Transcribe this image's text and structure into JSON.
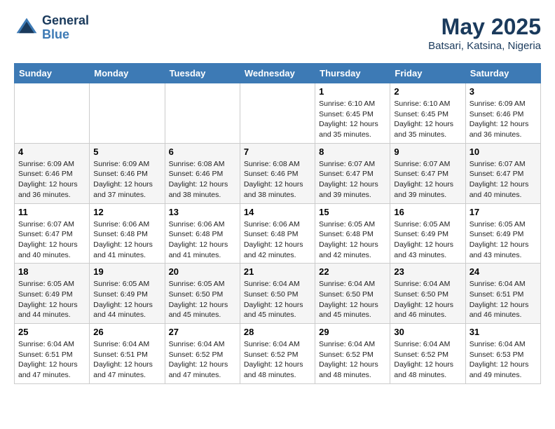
{
  "header": {
    "logo_line1": "General",
    "logo_line2": "Blue",
    "month_year": "May 2025",
    "location": "Batsari, Katsina, Nigeria"
  },
  "weekdays": [
    "Sunday",
    "Monday",
    "Tuesday",
    "Wednesday",
    "Thursday",
    "Friday",
    "Saturday"
  ],
  "weeks": [
    [
      {
        "day": "",
        "sunrise": "",
        "sunset": "",
        "daylight": ""
      },
      {
        "day": "",
        "sunrise": "",
        "sunset": "",
        "daylight": ""
      },
      {
        "day": "",
        "sunrise": "",
        "sunset": "",
        "daylight": ""
      },
      {
        "day": "",
        "sunrise": "",
        "sunset": "",
        "daylight": ""
      },
      {
        "day": "1",
        "sunrise": "Sunrise: 6:10 AM",
        "sunset": "Sunset: 6:45 PM",
        "daylight": "Daylight: 12 hours and 35 minutes."
      },
      {
        "day": "2",
        "sunrise": "Sunrise: 6:10 AM",
        "sunset": "Sunset: 6:45 PM",
        "daylight": "Daylight: 12 hours and 35 minutes."
      },
      {
        "day": "3",
        "sunrise": "Sunrise: 6:09 AM",
        "sunset": "Sunset: 6:46 PM",
        "daylight": "Daylight: 12 hours and 36 minutes."
      }
    ],
    [
      {
        "day": "4",
        "sunrise": "Sunrise: 6:09 AM",
        "sunset": "Sunset: 6:46 PM",
        "daylight": "Daylight: 12 hours and 36 minutes."
      },
      {
        "day": "5",
        "sunrise": "Sunrise: 6:09 AM",
        "sunset": "Sunset: 6:46 PM",
        "daylight": "Daylight: 12 hours and 37 minutes."
      },
      {
        "day": "6",
        "sunrise": "Sunrise: 6:08 AM",
        "sunset": "Sunset: 6:46 PM",
        "daylight": "Daylight: 12 hours and 38 minutes."
      },
      {
        "day": "7",
        "sunrise": "Sunrise: 6:08 AM",
        "sunset": "Sunset: 6:46 PM",
        "daylight": "Daylight: 12 hours and 38 minutes."
      },
      {
        "day": "8",
        "sunrise": "Sunrise: 6:07 AM",
        "sunset": "Sunset: 6:47 PM",
        "daylight": "Daylight: 12 hours and 39 minutes."
      },
      {
        "day": "9",
        "sunrise": "Sunrise: 6:07 AM",
        "sunset": "Sunset: 6:47 PM",
        "daylight": "Daylight: 12 hours and 39 minutes."
      },
      {
        "day": "10",
        "sunrise": "Sunrise: 6:07 AM",
        "sunset": "Sunset: 6:47 PM",
        "daylight": "Daylight: 12 hours and 40 minutes."
      }
    ],
    [
      {
        "day": "11",
        "sunrise": "Sunrise: 6:07 AM",
        "sunset": "Sunset: 6:47 PM",
        "daylight": "Daylight: 12 hours and 40 minutes."
      },
      {
        "day": "12",
        "sunrise": "Sunrise: 6:06 AM",
        "sunset": "Sunset: 6:48 PM",
        "daylight": "Daylight: 12 hours and 41 minutes."
      },
      {
        "day": "13",
        "sunrise": "Sunrise: 6:06 AM",
        "sunset": "Sunset: 6:48 PM",
        "daylight": "Daylight: 12 hours and 41 minutes."
      },
      {
        "day": "14",
        "sunrise": "Sunrise: 6:06 AM",
        "sunset": "Sunset: 6:48 PM",
        "daylight": "Daylight: 12 hours and 42 minutes."
      },
      {
        "day": "15",
        "sunrise": "Sunrise: 6:05 AM",
        "sunset": "Sunset: 6:48 PM",
        "daylight": "Daylight: 12 hours and 42 minutes."
      },
      {
        "day": "16",
        "sunrise": "Sunrise: 6:05 AM",
        "sunset": "Sunset: 6:49 PM",
        "daylight": "Daylight: 12 hours and 43 minutes."
      },
      {
        "day": "17",
        "sunrise": "Sunrise: 6:05 AM",
        "sunset": "Sunset: 6:49 PM",
        "daylight": "Daylight: 12 hours and 43 minutes."
      }
    ],
    [
      {
        "day": "18",
        "sunrise": "Sunrise: 6:05 AM",
        "sunset": "Sunset: 6:49 PM",
        "daylight": "Daylight: 12 hours and 44 minutes."
      },
      {
        "day": "19",
        "sunrise": "Sunrise: 6:05 AM",
        "sunset": "Sunset: 6:49 PM",
        "daylight": "Daylight: 12 hours and 44 minutes."
      },
      {
        "day": "20",
        "sunrise": "Sunrise: 6:05 AM",
        "sunset": "Sunset: 6:50 PM",
        "daylight": "Daylight: 12 hours and 45 minutes."
      },
      {
        "day": "21",
        "sunrise": "Sunrise: 6:04 AM",
        "sunset": "Sunset: 6:50 PM",
        "daylight": "Daylight: 12 hours and 45 minutes."
      },
      {
        "day": "22",
        "sunrise": "Sunrise: 6:04 AM",
        "sunset": "Sunset: 6:50 PM",
        "daylight": "Daylight: 12 hours and 45 minutes."
      },
      {
        "day": "23",
        "sunrise": "Sunrise: 6:04 AM",
        "sunset": "Sunset: 6:50 PM",
        "daylight": "Daylight: 12 hours and 46 minutes."
      },
      {
        "day": "24",
        "sunrise": "Sunrise: 6:04 AM",
        "sunset": "Sunset: 6:51 PM",
        "daylight": "Daylight: 12 hours and 46 minutes."
      }
    ],
    [
      {
        "day": "25",
        "sunrise": "Sunrise: 6:04 AM",
        "sunset": "Sunset: 6:51 PM",
        "daylight": "Daylight: 12 hours and 47 minutes."
      },
      {
        "day": "26",
        "sunrise": "Sunrise: 6:04 AM",
        "sunset": "Sunset: 6:51 PM",
        "daylight": "Daylight: 12 hours and 47 minutes."
      },
      {
        "day": "27",
        "sunrise": "Sunrise: 6:04 AM",
        "sunset": "Sunset: 6:52 PM",
        "daylight": "Daylight: 12 hours and 47 minutes."
      },
      {
        "day": "28",
        "sunrise": "Sunrise: 6:04 AM",
        "sunset": "Sunset: 6:52 PM",
        "daylight": "Daylight: 12 hours and 48 minutes."
      },
      {
        "day": "29",
        "sunrise": "Sunrise: 6:04 AM",
        "sunset": "Sunset: 6:52 PM",
        "daylight": "Daylight: 12 hours and 48 minutes."
      },
      {
        "day": "30",
        "sunrise": "Sunrise: 6:04 AM",
        "sunset": "Sunset: 6:52 PM",
        "daylight": "Daylight: 12 hours and 48 minutes."
      },
      {
        "day": "31",
        "sunrise": "Sunrise: 6:04 AM",
        "sunset": "Sunset: 6:53 PM",
        "daylight": "Daylight: 12 hours and 49 minutes."
      }
    ]
  ]
}
